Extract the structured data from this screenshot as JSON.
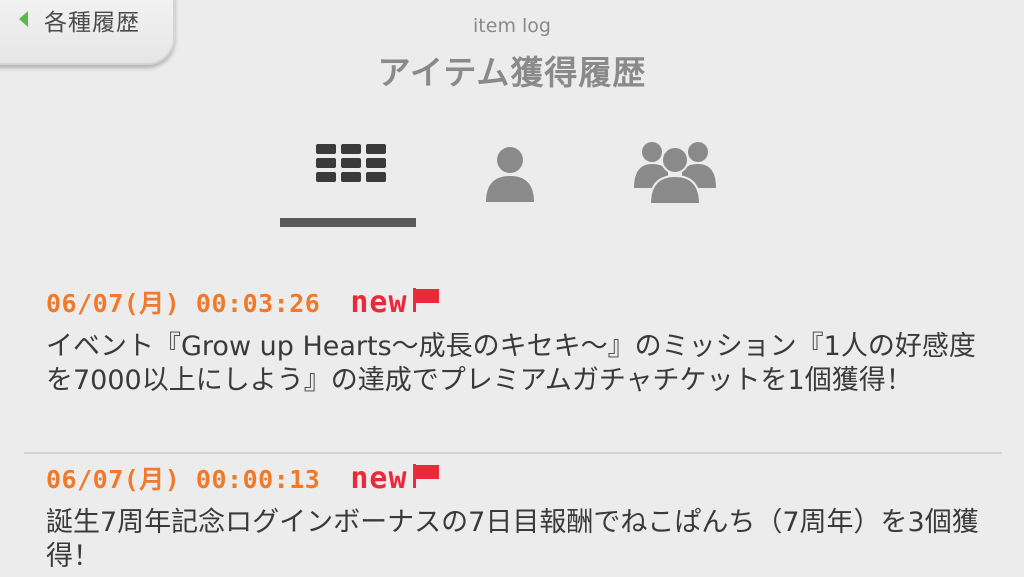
{
  "header": {
    "back_label": "各種履歴",
    "subtitle": "item log",
    "title": "アイテム獲得履歴"
  },
  "tabs": [
    {
      "icon": "grid-icon",
      "selected": true
    },
    {
      "icon": "person-icon",
      "selected": false
    },
    {
      "icon": "group-icon",
      "selected": false
    }
  ],
  "colors": {
    "background": "#ececec",
    "timestamp": "#f07a2a",
    "new_badge": "#ea2a3a",
    "back_arrow": "#58b94c"
  },
  "entries": [
    {
      "timestamp": "06/07(月) 00:03:26",
      "badge": "new",
      "message": "イベント『Grow up Hearts～成長のキセキ～』のミッション『1人の好感度を7000以上にしよう』の達成でプレミアムガチャチケットを1個獲得！"
    },
    {
      "timestamp": "06/07(月) 00:00:13",
      "badge": "new",
      "message": "誕生7周年記念ログインボーナスの7日目報酬でねこぱんち（7周年）を3個獲得！"
    }
  ]
}
